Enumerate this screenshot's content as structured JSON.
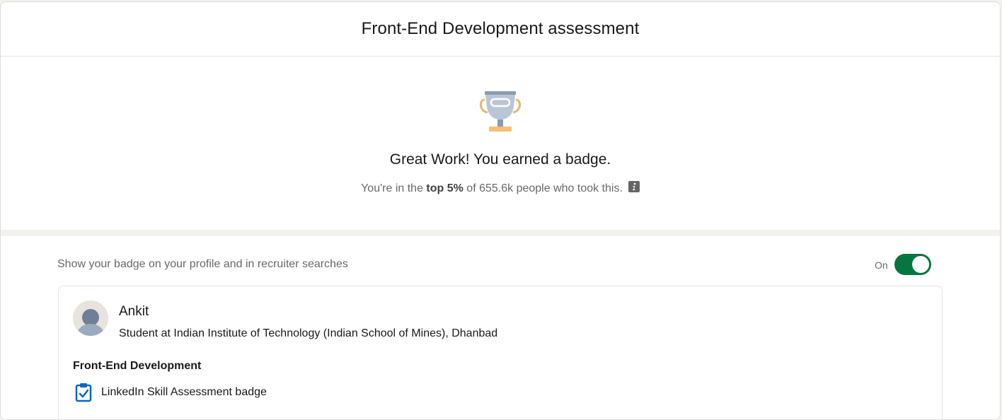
{
  "header": {
    "title": "Front-End Development assessment"
  },
  "result": {
    "trophy_icon": "trophy-icon",
    "headline": "Great Work! You earned a badge.",
    "subline_prefix": "You're in the ",
    "subline_bold": "top 5%",
    "subline_suffix": " of 655.6k people who took this.",
    "info_icon": "info-icon"
  },
  "badge_visibility": {
    "label": "Show your badge on your profile and in recruiter searches",
    "state_label": "On",
    "enabled": true,
    "accent_color": "#057642"
  },
  "preview": {
    "name": "Ankit",
    "headline": "Student at Indian Institute of Technology (Indian School of Mines), Dhanbad",
    "skill": "Front-End Development",
    "badge_label": "LinkedIn Skill Assessment badge",
    "badge_icon": "clipboard-check-icon"
  }
}
